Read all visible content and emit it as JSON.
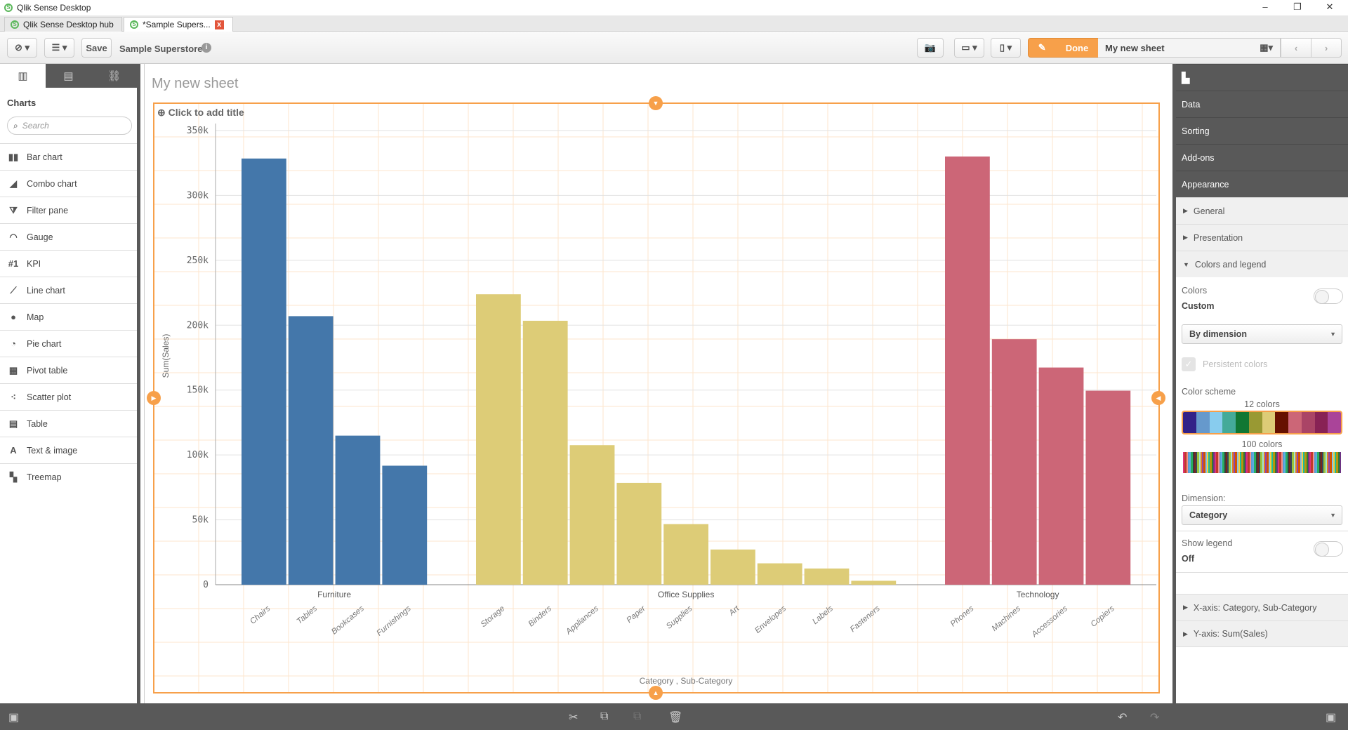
{
  "window": {
    "title": "Qlik Sense Desktop",
    "minimize": "–",
    "restore": "❐",
    "close": "✕"
  },
  "tabs": [
    {
      "label": "Qlik Sense Desktop hub"
    },
    {
      "label": "*Sample Supers...",
      "close": "x"
    }
  ],
  "toolbar": {
    "save_label": "Save",
    "app_name": "Sample Superstore",
    "done_label": "Done",
    "sheet_name": "My new sheet"
  },
  "left_panel": {
    "heading": "Charts",
    "search_placeholder": "Search",
    "items": [
      {
        "label": "Bar chart",
        "icon": "▮▮"
      },
      {
        "label": "Combo chart",
        "icon": "◢"
      },
      {
        "label": "Filter pane",
        "icon": "⧩"
      },
      {
        "label": "Gauge",
        "icon": "◠"
      },
      {
        "label": "KPI",
        "icon": "#1"
      },
      {
        "label": "Line chart",
        "icon": "⟋"
      },
      {
        "label": "Map",
        "icon": "●"
      },
      {
        "label": "Pie chart",
        "icon": "◔"
      },
      {
        "label": "Pivot table",
        "icon": "▦"
      },
      {
        "label": "Scatter plot",
        "icon": "⁖"
      },
      {
        "label": "Table",
        "icon": "▤"
      },
      {
        "label": "Text & image",
        "icon": "A"
      },
      {
        "label": "Treemap",
        "icon": "▚"
      }
    ]
  },
  "sheet": {
    "title": "My new sheet",
    "chart_title_placeholder": "Click to add title"
  },
  "right_panel": {
    "sections": [
      "Data",
      "Sorting",
      "Add-ons",
      "Appearance"
    ],
    "appearance": [
      "General",
      "Presentation",
      "Colors and legend"
    ],
    "colors_label": "Colors",
    "colors_value": "Custom",
    "colors_mode": "By dimension",
    "persistent_colors": "Persistent colors",
    "color_scheme_label": "Color scheme",
    "scheme_12_label": "12 colors",
    "scheme_100_label": "100 colors",
    "scheme_12": [
      "#332288",
      "#6699cc",
      "#88ccee",
      "#44aa99",
      "#117733",
      "#999933",
      "#ddcc77",
      "#661100",
      "#cc6677",
      "#aa4466",
      "#882255",
      "#aa4499"
    ],
    "scheme_100_sample": [
      "#e0327a",
      "#5a9bd4",
      "#3b3b3b",
      "#9bc53d",
      "#8e44ad",
      "#f4d03f",
      "#2e7d32",
      "#c0392b",
      "#5dade2",
      "#7b241c",
      "#a3e4d7",
      "#d35400",
      "#1abc9c",
      "#6c3483",
      "#f1948a",
      "#27ae60",
      "#34495e",
      "#e67e22",
      "#85c1e9",
      "#b7950b"
    ],
    "dimension_label": "Dimension:",
    "dimension_value": "Category",
    "show_legend_label": "Show legend",
    "show_legend_value": "Off",
    "xaxis": "X-axis: Category, Sub-Category",
    "yaxis": "Y-axis: Sum(Sales)"
  },
  "chart_data": {
    "type": "bar",
    "title": "",
    "xlabel": "Category , Sub-Category",
    "ylabel": "Sum(Sales)",
    "ylim": [
      0,
      350000
    ],
    "yticks": [
      {
        "v": 0,
        "label": "0"
      },
      {
        "v": 50000,
        "label": "50k"
      },
      {
        "v": 100000,
        "label": "100k"
      },
      {
        "v": 150000,
        "label": "150k"
      },
      {
        "v": 200000,
        "label": "200k"
      },
      {
        "v": 250000,
        "label": "250k"
      },
      {
        "v": 300000,
        "label": "300k"
      },
      {
        "v": 350000,
        "label": "350k"
      }
    ],
    "grid": true,
    "legend": "none",
    "groups": [
      {
        "name": "Furniture",
        "color": "#4477aa",
        "categories": [
          "Chairs",
          "Tables",
          "Bookcases",
          "Furnishings"
        ],
        "values": [
          328449,
          206966,
          114880,
          91705
        ]
      },
      {
        "name": "Office Supplies",
        "color": "#ddcc77",
        "categories": [
          "Storage",
          "Binders",
          "Appliances",
          "Paper",
          "Supplies",
          "Art",
          "Envelopes",
          "Labels",
          "Fasteners"
        ],
        "values": [
          223844,
          203413,
          107532,
          78479,
          46674,
          27119,
          16476,
          12486,
          3024
        ]
      },
      {
        "name": "Technology",
        "color": "#cc6677",
        "categories": [
          "Phones",
          "Machines",
          "Accessories",
          "Copiers"
        ],
        "values": [
          330007,
          189239,
          167380,
          149528
        ]
      }
    ]
  }
}
